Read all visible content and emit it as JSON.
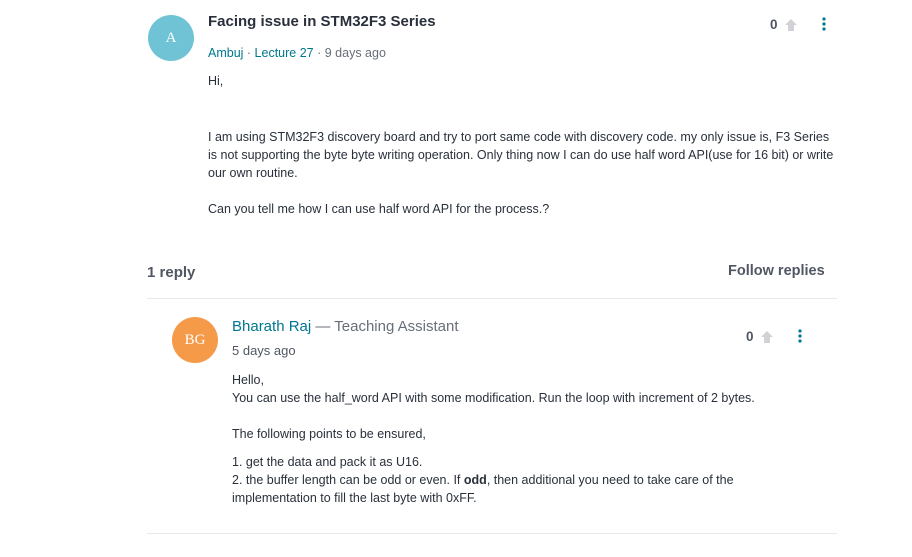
{
  "question": {
    "avatar_initials": "A",
    "avatar_color": "#70c3d5",
    "title": "Facing issue in STM32F3 Series",
    "author": "Ambuj",
    "lecture": "Lecture 27",
    "time": "9 days ago",
    "sep1": " · ",
    "sep2": " · ",
    "votes": "0",
    "body": [
      "Hi,",
      "I am using STM32F3 discovery board and try to port same code with discovery code. my only issue is, F3 Series is not supporting the byte byte writing operation. Only thing now I can do use half word API(use for 16 bit) or write our own routine.",
      "Can you tell me how I can use half word API for the process.?"
    ]
  },
  "replies_header": {
    "count_label": "1 reply",
    "follow_label": "Follow replies"
  },
  "reply": {
    "avatar_initials": "BG",
    "avatar_color": "#f59a49",
    "name": "Bharath Raj",
    "role": " — Teaching Assistant",
    "time": "5 days ago",
    "votes": "0",
    "body": {
      "line1": "Hello,",
      "line2": "You can use the half_word API with some modification. Run the loop with increment of 2 bytes.",
      "line3": "The following points to be ensured,",
      "point1": "1. get the data and pack it as U16.",
      "point2_prefix": "2. the buffer length can be odd or even. If ",
      "point2_bold": "odd",
      "point2_suffix": ", then additional you need to take care of the implementation to fill the last byte with 0xFF."
    }
  },
  "colors": {
    "link": "#007791",
    "arrow": "#d0d2d6",
    "kebab": "#007791"
  }
}
